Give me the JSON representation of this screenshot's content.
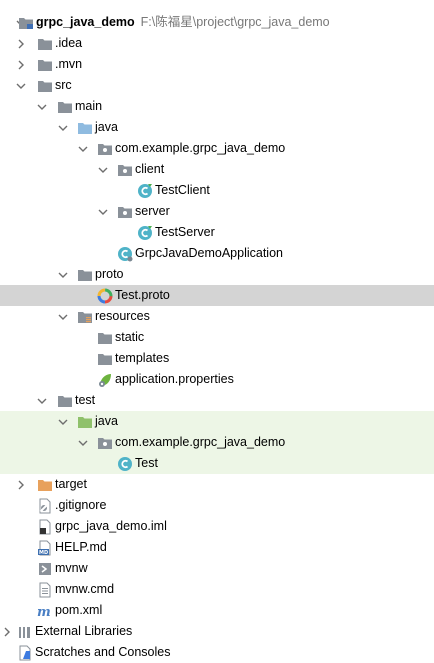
{
  "tree": {
    "root": {
      "name": "grpc_java_demo",
      "path": "F:\\陈福星\\project\\grpc_java_demo"
    },
    "idea": ".idea",
    "mvn": ".mvn",
    "src": "src",
    "main": "main",
    "main_java": "java",
    "main_package": "com.example.grpc_java_demo",
    "client": "client",
    "test_client": "TestClient",
    "server": "server",
    "test_server": "TestServer",
    "app_class": "GrpcJavaDemoApplication",
    "proto": "proto",
    "test_proto": "Test.proto",
    "resources": "resources",
    "static": "static",
    "templates": "templates",
    "app_properties": "application.properties",
    "test": "test",
    "test_java": "java",
    "test_package": "com.example.grpc_java_demo",
    "test_class": "Test",
    "target": "target",
    "gitignore": ".gitignore",
    "iml": "grpc_java_demo.iml",
    "help": "HELP.md",
    "mvnw": "mvnw",
    "mvnw_cmd": "mvnw.cmd",
    "pom": "pom.xml",
    "external_libraries": "External Libraries",
    "scratches": "Scratches and Consoles"
  },
  "colors": {
    "folder_gray": "#8a9199",
    "folder_blue": "#8fbbe0",
    "folder_green": "#8fc16b",
    "folder_orange": "#e8a15c",
    "class_cyan": "#4fb3c8",
    "selection": "#d4d4d4",
    "test_highlight": "#edf6e6"
  }
}
